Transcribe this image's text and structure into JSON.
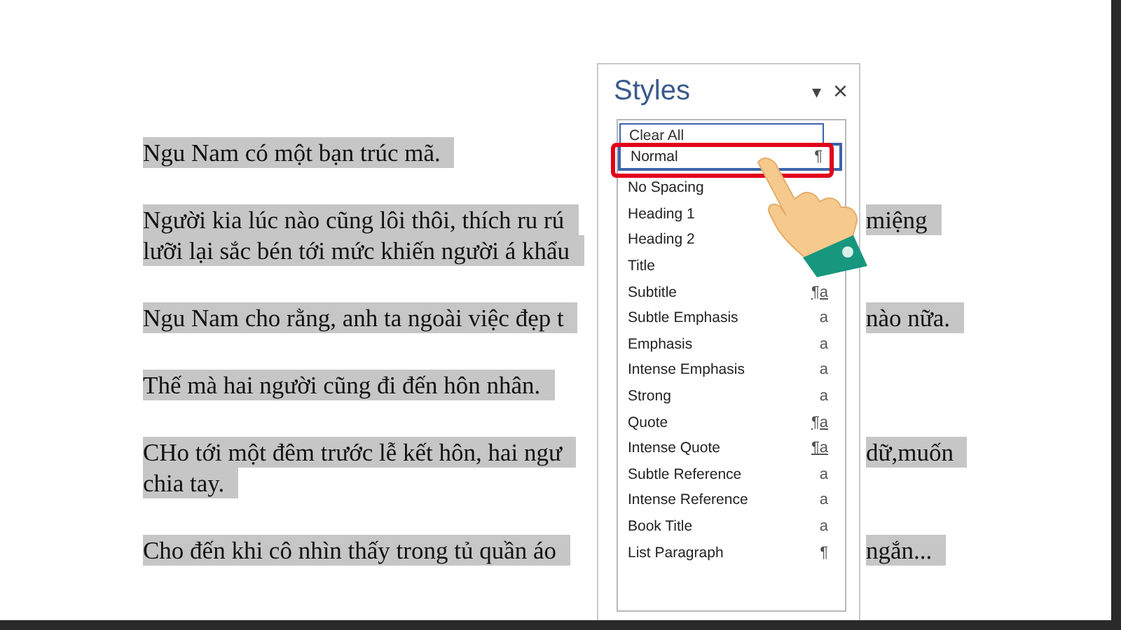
{
  "document": {
    "paragraphs": [
      {
        "lines": [
          {
            "left": "Ngu Nam có một bạn trúc mã."
          }
        ]
      },
      {
        "lines": [
          {
            "left": "Người kia lúc nào cũng lôi thôi, thích ru rú",
            "right": "miệng"
          },
          {
            "left": "lưỡi lại sắc bén tới mức khiến người á khẩu"
          }
        ]
      },
      {
        "lines": [
          {
            "left": "Ngu Nam cho rằng, anh ta ngoài việc đẹp t",
            "right": "nào nữa."
          }
        ]
      },
      {
        "lines": [
          {
            "left": "Thế mà hai người cũng đi đến hôn nhân."
          }
        ]
      },
      {
        "lines": [
          {
            "left": "CHo tới một đêm trước lễ kết hôn, hai ngư",
            "right": "dữ,muốn"
          },
          {
            "left": "chia tay."
          }
        ]
      },
      {
        "lines": [
          {
            "left": "Cho đến khi cô nhìn thấy trong tủ quần áo",
            "right": "ngắn..."
          }
        ]
      }
    ]
  },
  "styles_pane": {
    "title": "Styles",
    "menu_caret": "▾",
    "close": "×",
    "clear_all": "Clear All",
    "items": [
      {
        "label": "Normal",
        "selected": true,
        "mark": "¶",
        "kind": "paragraph"
      },
      {
        "label": "No Spacing",
        "selected": false
      },
      {
        "label": "Heading 1",
        "selected": false
      },
      {
        "label": "Heading 2",
        "selected": false
      },
      {
        "label": "Title",
        "selected": false
      },
      {
        "label": "Subtitle",
        "selected": false,
        "mark": "¶a",
        "kind": "linked"
      },
      {
        "label": "Subtle Emphasis",
        "selected": false,
        "mark": "a",
        "kind": "character"
      },
      {
        "label": "Emphasis",
        "selected": false,
        "mark": "a",
        "kind": "character"
      },
      {
        "label": "Intense Emphasis",
        "selected": false,
        "mark": "a",
        "kind": "character"
      },
      {
        "label": "Strong",
        "selected": false,
        "mark": "a",
        "kind": "character"
      },
      {
        "label": "Quote",
        "selected": false,
        "mark": "¶a",
        "kind": "linked"
      },
      {
        "label": "Intense Quote",
        "selected": false,
        "mark": "¶a",
        "kind": "linked"
      },
      {
        "label": "Subtle Reference",
        "selected": false,
        "mark": "a",
        "kind": "character"
      },
      {
        "label": "Intense Reference",
        "selected": false,
        "mark": "a",
        "kind": "character"
      },
      {
        "label": "Book Title",
        "selected": false,
        "mark": "a",
        "kind": "character"
      },
      {
        "label": "List Paragraph",
        "selected": false,
        "mark": "¶",
        "kind": "paragraph"
      }
    ]
  }
}
